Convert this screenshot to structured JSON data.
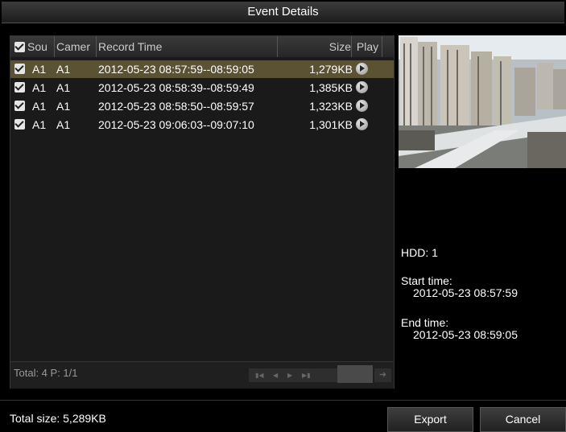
{
  "title": "Event Details",
  "columns": {
    "source": "Sou",
    "camera": "Camer",
    "record_time": "Record Time",
    "size": "Size",
    "play": "Play"
  },
  "rows": [
    {
      "source": "A1",
      "camera": "A1",
      "record_time": "2012-05-23 08:57:59--08:59:05",
      "size": "1,279KB",
      "checked": true,
      "selected": true
    },
    {
      "source": "A1",
      "camera": "A1",
      "record_time": "2012-05-23 08:58:39--08:59:49",
      "size": "1,385KB",
      "checked": true,
      "selected": false
    },
    {
      "source": "A1",
      "camera": "A1",
      "record_time": "2012-05-23 08:58:50--08:59:57",
      "size": "1,323KB",
      "checked": true,
      "selected": false
    },
    {
      "source": "A1",
      "camera": "A1",
      "record_time": "2012-05-23 09:06:03--09:07:10",
      "size": "1,301KB",
      "checked": true,
      "selected": false
    }
  ],
  "footer": {
    "total_label": "Total: 4  P: 1/1",
    "page_input": ""
  },
  "details": {
    "hdd": "HDD: 1",
    "start_label": "Start time:",
    "start_value": "2012-05-23 08:57:59",
    "end_label": "End time:",
    "end_value": "2012-05-23 08:59:05"
  },
  "total_size": "Total size: 5,289KB",
  "buttons": {
    "export": "Export",
    "cancel": "Cancel"
  },
  "colors": {
    "selected_row": "#5b5234",
    "background": "#000000"
  },
  "icons": {
    "play": "play-icon",
    "checkbox": "checkbox-checked-icon"
  }
}
